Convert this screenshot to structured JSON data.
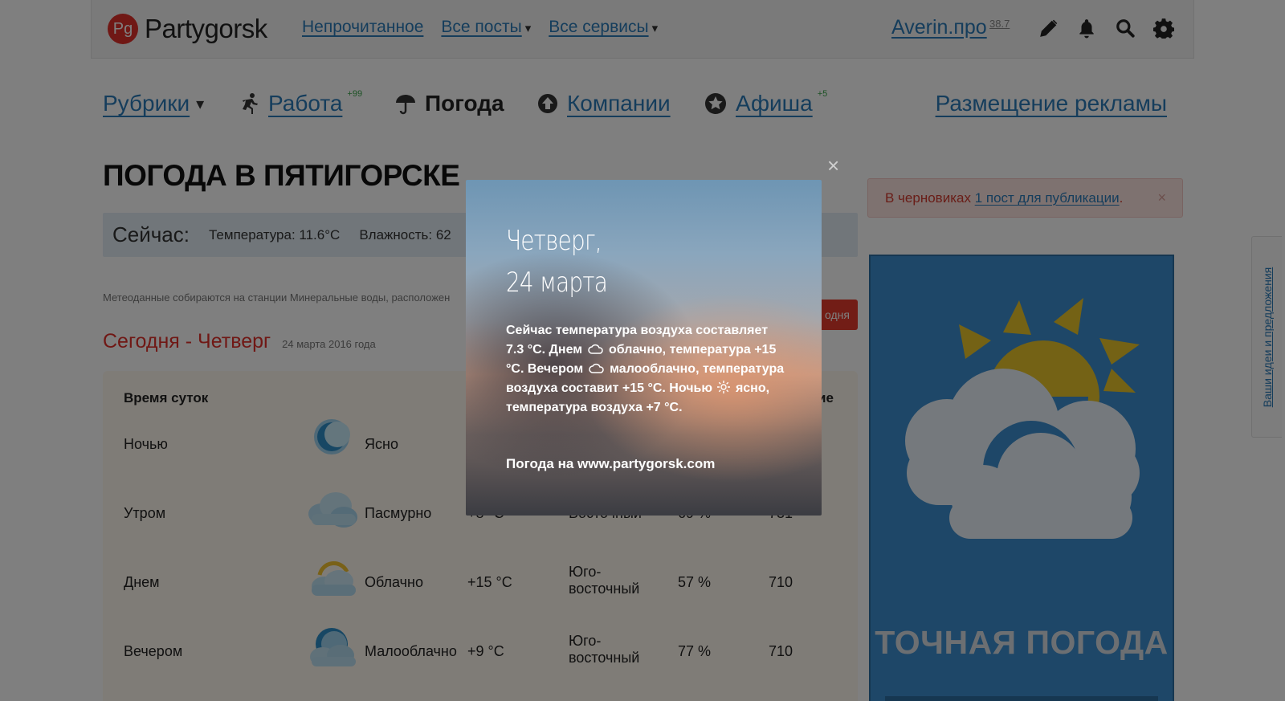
{
  "header": {
    "logo_badge": "Pg",
    "logo_text": "Partygorsk",
    "nav": [
      {
        "label": "Непрочитанное"
      },
      {
        "label": "Все посты"
      },
      {
        "label": "Все сервисы"
      }
    ],
    "dropdown_glyph": "▾",
    "user_name": "Averin.про",
    "user_score": "38.7",
    "icons": [
      "pencil-icon",
      "bell-icon",
      "search-icon",
      "gear-icon"
    ]
  },
  "sections": {
    "rubrics": "Рубрики",
    "rubrics_arrow": "▾",
    "work": "Работа",
    "work_badge": "+99",
    "weather": "Погода",
    "companies": "Компании",
    "events": "Афиша",
    "events_badge": "+5",
    "ads": "Размещение рекламы"
  },
  "page": {
    "title": "ПОГОДА В ПЯТИГОРСКЕ",
    "now_label": "Сейчас:",
    "now_temperature": "Температура: 11.6°C",
    "now_humidity": "Влажность: 62",
    "meteo_note": "Метеоданные собираются на станции Минеральные воды, расположен",
    "today_button": "одня",
    "today_title": "Сегодня - Четверг",
    "today_date": "24 марта 2016 года"
  },
  "table": {
    "headers": {
      "time": "Время суток",
      "right_fragment": "ие"
    },
    "rows": [
      {
        "time": "Ночью",
        "condition": "Ясно",
        "temp": "",
        "wind": "",
        "humidity": "",
        "pressure": "",
        "icon": "moon-icon"
      },
      {
        "time": "Утром",
        "condition": "Пасмурно",
        "temp": "+8 °C",
        "wind": "Восточный",
        "humidity": "69 %",
        "pressure": "731",
        "icon": "overcast-icon"
      },
      {
        "time": "Днем",
        "condition": "Облачно",
        "temp": "+15 °C",
        "wind_line1": "Юго-",
        "wind_line2": "восточный",
        "humidity": "57 %",
        "pressure": "710",
        "icon": "cloudy-icon"
      },
      {
        "time": "Вечером",
        "condition": "Малооблачно",
        "temp": "+9 °C",
        "wind_line1": "Юго-",
        "wind_line2": "восточный",
        "humidity": "77 %",
        "pressure": "710",
        "icon": "partly-cloudy-icon"
      }
    ]
  },
  "sidebar": {
    "draft_text": "В черновиках",
    "draft_link": "1 пост для публикации",
    "draft_period": ".",
    "close_glyph": "×",
    "ad_text": "ТОЧНАЯ ПОГОДА",
    "feedback": "Ваши идеи и предложения"
  },
  "modal": {
    "close_glyph": "×",
    "day": "Четверг,",
    "date": "24 марта",
    "desc_1": "Сейчас температура воздуха составляет 7.3 °C. Днем",
    "desc_2": "облачно, температура +15 °C. Вечером",
    "desc_3": "малооблачно, температура воздуха составит +15 °C. Ночью",
    "desc_4": "ясно, температура воздуха +7 °C.",
    "source": "Погода на www.partygorsk.com"
  },
  "colors": {
    "link": "#2a7bb8",
    "accent_red": "#e0302a",
    "ad_blue": "#3d8fd0",
    "sun_yellow": "#e9c42a"
  }
}
